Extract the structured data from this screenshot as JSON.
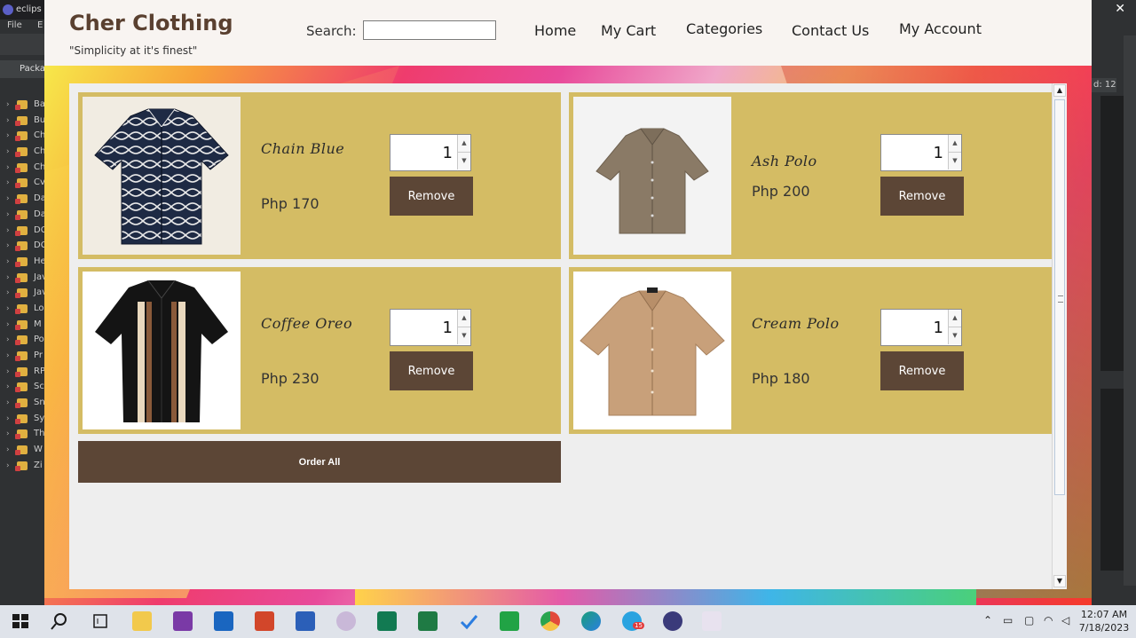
{
  "ide": {
    "title": "eclips",
    "menu_file": "File",
    "menu_edit": "E",
    "package_tab": "Packa",
    "tree_labels": [
      "Ba",
      "Bu",
      "Ch",
      "Ch",
      "Ch",
      "Cv",
      "Da",
      "Da",
      "DC",
      "DC",
      "He",
      "Jav",
      "Jav",
      "Lo",
      "M",
      "Po",
      "Pr",
      "RP",
      "Sc",
      "Sn",
      "Sy",
      "Th",
      "W",
      "Zi"
    ],
    "right_label": "d: 12",
    "close_glyph": "✕"
  },
  "header": {
    "brand": "Cher Clothing",
    "tagline": "\"Simplicity at it's finest\"",
    "search_label": "Search:",
    "search_value": "",
    "nav": [
      "Home",
      "My Cart",
      "Categories",
      "Contact Us",
      "My Account"
    ]
  },
  "cart": {
    "items": [
      {
        "name": "Chain Blue",
        "price": "Php 170",
        "qty": "1",
        "remove_label": "Remove",
        "image": "shirt-navy-chain-pattern"
      },
      {
        "name": "Ash Polo",
        "price": "Php 200",
        "qty": "1",
        "remove_label": "Remove",
        "image": "shirt-ash-polo"
      },
      {
        "name": "Coffee Oreo",
        "price": "Php 230",
        "qty": "1",
        "remove_label": "Remove",
        "image": "shirt-coffee-oreo-stripes"
      },
      {
        "name": "Cream Polo",
        "price": "Php 180",
        "qty": "1",
        "remove_label": "Remove",
        "image": "shirt-cream-polo"
      }
    ],
    "order_all_label": "Order All"
  },
  "taskbar": {
    "time": "12:07 AM",
    "date": "7/18/2023",
    "badge": "15"
  },
  "colors": {
    "card_bg": "#d4bc64",
    "button_bg": "#5c4636",
    "header_bg": "#f8f4f1",
    "content_bg": "#eeeeee"
  }
}
